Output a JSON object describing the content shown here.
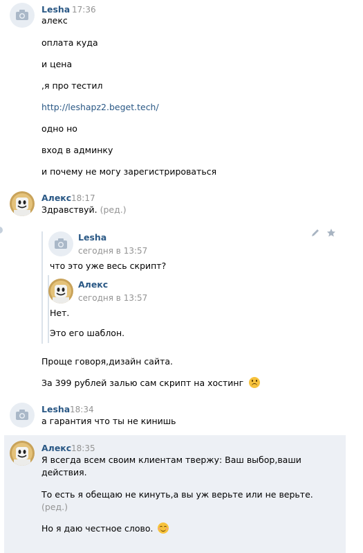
{
  "messages": {
    "m1": {
      "author": "Lesha",
      "time": "17:36",
      "lines": [
        "алекс",
        "оплата куда",
        "и цена",
        ",я про тестил",
        "http://leshapz2.beget.tech/",
        "одно но",
        "вход в админку",
        "и почему не могу зарегистрироваться"
      ]
    },
    "m2": {
      "author": "Алекс",
      "time": "18:17",
      "text": "Здравствуй.",
      "edited": "(ред.)",
      "fwd": {
        "author": "Lesha",
        "time": "сегодня в 13:57",
        "text": "что это уже весь скрипт?",
        "nested": {
          "author": "Алекс",
          "time": "сегодня в 13:57",
          "lines": [
            "Нет.",
            "Это его шаблон."
          ]
        }
      },
      "after": [
        "Проще говоря,дизайн сайта.",
        "За 399 рублей залью сам скрипт на хостинг"
      ]
    },
    "m3": {
      "author": "Lesha",
      "time": "18:34",
      "text": "а гарантия что ты не кинишь"
    },
    "m4": {
      "author": "Алекс",
      "time": "18:35",
      "lines": [
        "Я всегда всем своим клиентам твержу: Ваш выбор,ваши",
        "действия.",
        "То есть я обещаю не кинуть,а вы уж верьте или не верьте.",
        "(ред.)",
        "Но я даю честное слово."
      ]
    }
  },
  "colors": {
    "name": "#2a5885",
    "time": "#939393",
    "highlight": "#edf0f5",
    "fwd_bar": "#dbe2ea"
  },
  "icons": [
    "camera-icon",
    "pencil-icon",
    "star-icon",
    "emoji-upside-down-icon",
    "emoji-smile-icon",
    "marshmello-avatar"
  ]
}
